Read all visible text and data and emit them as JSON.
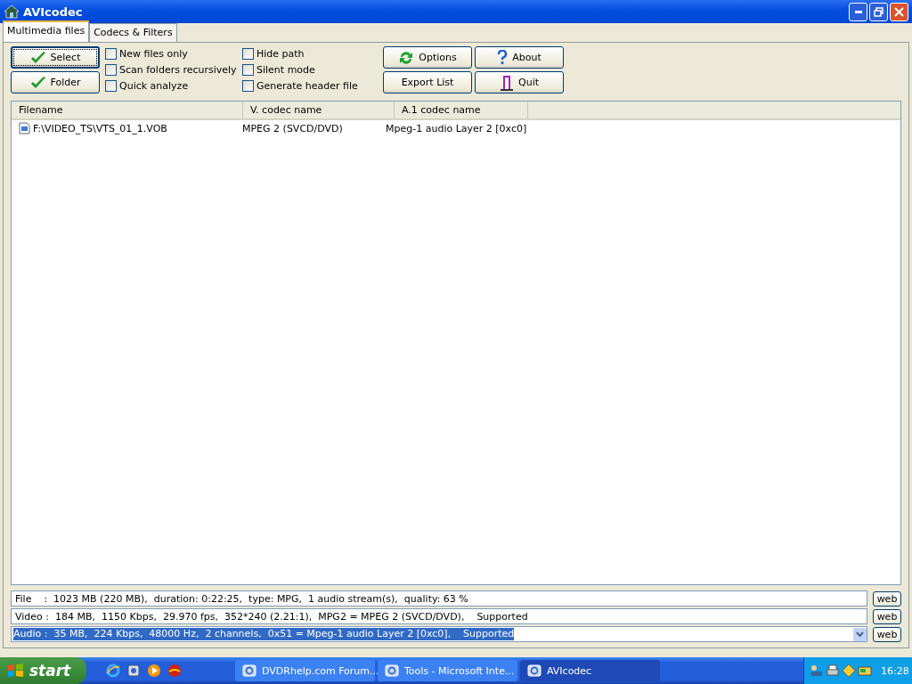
{
  "window": {
    "title": "AVIcodec"
  },
  "tabs": [
    {
      "label": "Multimedia files",
      "selected": true
    },
    {
      "label": "Codecs & Filters",
      "selected": false
    }
  ],
  "left_buttons": [
    {
      "label": "Select",
      "focused": true
    },
    {
      "label": "Folder",
      "focused": false
    }
  ],
  "options_col1": [
    {
      "label": "New files only",
      "checked": false
    },
    {
      "label": "Scan folders recursively",
      "checked": false
    },
    {
      "label": "Quick analyze",
      "checked": false
    }
  ],
  "options_col2": [
    {
      "label": "Hide path",
      "checked": false
    },
    {
      "label": "Silent mode",
      "checked": false
    },
    {
      "label": "Generate header file",
      "checked": false
    }
  ],
  "right_buttons": [
    {
      "label": "Options",
      "kind": "refresh"
    },
    {
      "label": "About",
      "kind": "help"
    },
    {
      "label": "Export List",
      "kind": "none"
    },
    {
      "label": "Quit",
      "kind": "quit"
    }
  ],
  "table": {
    "columns": [
      "Filename",
      "V. codec name",
      "A.1 codec name"
    ],
    "rows": [
      [
        "F:\\VIDEO_TS\\VTS_01_1.VOB",
        "MPEG 2 (SVCD/DVD)",
        "Mpeg-1 audio Layer 2 [0xc0]"
      ]
    ]
  },
  "info_rows": [
    {
      "kind": "text",
      "text": "File    :  1023 MB (220 MB),  duration: 0:22:25,  type: MPG,  1 audio stream(s),  quality: 63 %",
      "button": "web"
    },
    {
      "kind": "text",
      "text": "Video :  184 MB,  1150 Kbps,  29.970 fps,  352*240 (2.21:1),  MPG2 = MPEG 2 (SVCD/DVD),    Supported",
      "button": "web"
    },
    {
      "kind": "combo",
      "text": "Audio :  35 MB,  224 Kbps,  48000 Hz,  2 channels,  0x51 = Mpeg-1 audio Layer 2 [0xc0],    Supported",
      "button": "web"
    }
  ],
  "taskbar": {
    "start": "start",
    "tasks": [
      {
        "label": "DVDRhelp.com Forum...",
        "selected": false
      },
      {
        "label": "Tools - Microsoft Inte...",
        "selected": false
      },
      {
        "label": "AVIcodec",
        "selected": true
      }
    ],
    "clock": "16:28"
  }
}
